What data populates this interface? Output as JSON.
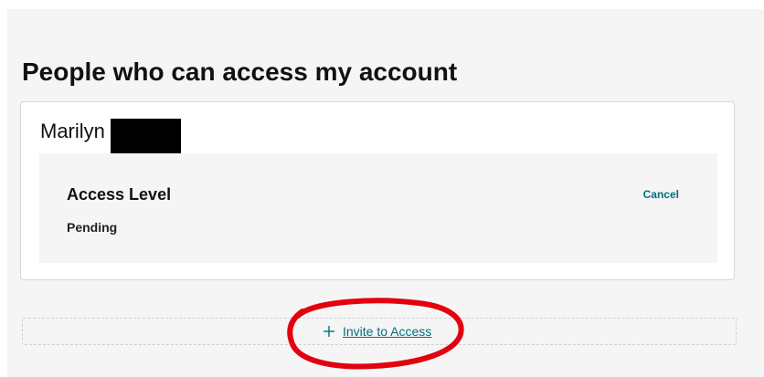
{
  "page": {
    "title": "People who can access my account"
  },
  "person": {
    "first_name": "Marilyn",
    "access_label": "Access Level",
    "status": "Pending",
    "cancel_label": "Cancel"
  },
  "invite": {
    "label": "Invite to Access",
    "icon": "plus-icon"
  },
  "colors": {
    "link": "#00717f",
    "annotation": "#e3000f",
    "panel_background": "#f5f5f5"
  }
}
